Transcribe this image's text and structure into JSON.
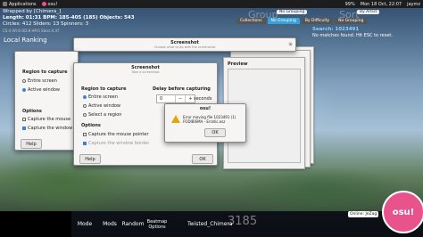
{
  "panel": {
    "applications": "Applications",
    "osu_label": "osu!",
    "battery": "99%",
    "clock": "Mon 18 Oct, 22:07",
    "user": "jaymz"
  },
  "song": {
    "title": "Wrapped by [Chimera_]",
    "length_line": "Length: 01:31 BPM: 185-405 (185) Objects: 543",
    "circles_line": "Circles: 412 Sliders: 13 Spinners: 3",
    "stats_line": "CS:4 AR:8 OD:8 HP:6 Stars:4.47"
  },
  "header": {
    "group_word": "Group",
    "sort_word": "Sort",
    "group_value": "No Grouping",
    "sort_value": "By Artist",
    "tabs": [
      "Collections",
      "No Grouping",
      "By Difficulty",
      "No Grouping"
    ],
    "mode_label": "osu!",
    "mode_value": "All"
  },
  "search": {
    "query": "Search: 1023491",
    "hint": "No matches found. Hit ESC to reset."
  },
  "local_ranking": "Local Ranking",
  "screenshot_back": {
    "region_header": "Region to capture",
    "entire_screen": "Entire screen",
    "active_window": "Active window",
    "options_header": "Options",
    "capture_mouse": "Capture the mouse",
    "capture_border": "Capture the window",
    "help": "Help"
  },
  "screenshot_front": {
    "title": "Screenshot",
    "subtitle": "Take a screenshot",
    "region_header": "Region to capture",
    "entire_screen": "Entire screen",
    "active_window": "Active window",
    "select_region": "Select a region",
    "delay_header": "Delay before capturing",
    "delay_value": "0",
    "delay_unit": "seconds",
    "options_header": "Options",
    "capture_mouse": "Capture the mouse pointer",
    "capture_border": "Capture the window border",
    "help": "Help",
    "ok": "OK"
  },
  "top_screenshot": {
    "title": "Screenshot",
    "subtitle": "Choose what to do with the screenshot",
    "preview": "Preview"
  },
  "error": {
    "title": "osu!",
    "message": "Error moving file 1023491 (1) FODIBISMA - Erratic.osz",
    "ok": "OK"
  },
  "bottom": {
    "mode": "Mode",
    "mods": "Mods",
    "random": "Random",
    "options": "Beatmap Options",
    "player": "Twisted_Chimera",
    "watermark": "3185",
    "online": "Online: JeZag",
    "osu": "osu!"
  },
  "colors": {
    "accent": "#3584e4",
    "osu_pink": "#e7538a",
    "warning": "#e5a50a"
  }
}
